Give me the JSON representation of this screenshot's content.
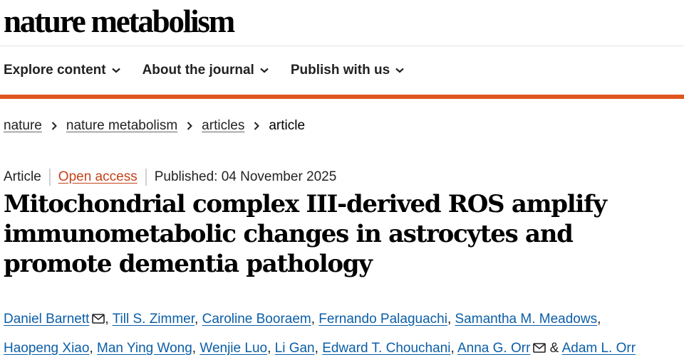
{
  "header": {
    "logo": "nature metabolism"
  },
  "nav": [
    {
      "label": "Explore content"
    },
    {
      "label": "About the journal"
    },
    {
      "label": "Publish with us"
    }
  ],
  "breadcrumb": [
    "nature",
    "nature metabolism",
    "articles",
    "article"
  ],
  "meta": {
    "type": "Article",
    "access": "Open access",
    "published": "Published: 04 November 2025"
  },
  "title": "Mitochondrial complex III-derived ROS amplify immunometabolic changes in astrocytes and promote dementia pathology",
  "authors": [
    "Daniel Barnett",
    "Till S. Zimmer",
    "Caroline Booraem",
    "Fernando Palaguachi",
    "Samantha M. Meadows",
    "Haopeng Xiao",
    "Man Ying Wong",
    "Wenjie Luo",
    "Li Gan",
    "Edward T. Chouchani",
    "Anna G. Orr",
    "Adam L. Orr"
  ],
  "colors": {
    "accent": "#e0561f",
    "link": "#0b5ea8",
    "open_access": "#c4421a"
  },
  "icons": [
    "chevron-down-icon",
    "chevron-right-icon",
    "email-icon"
  ]
}
